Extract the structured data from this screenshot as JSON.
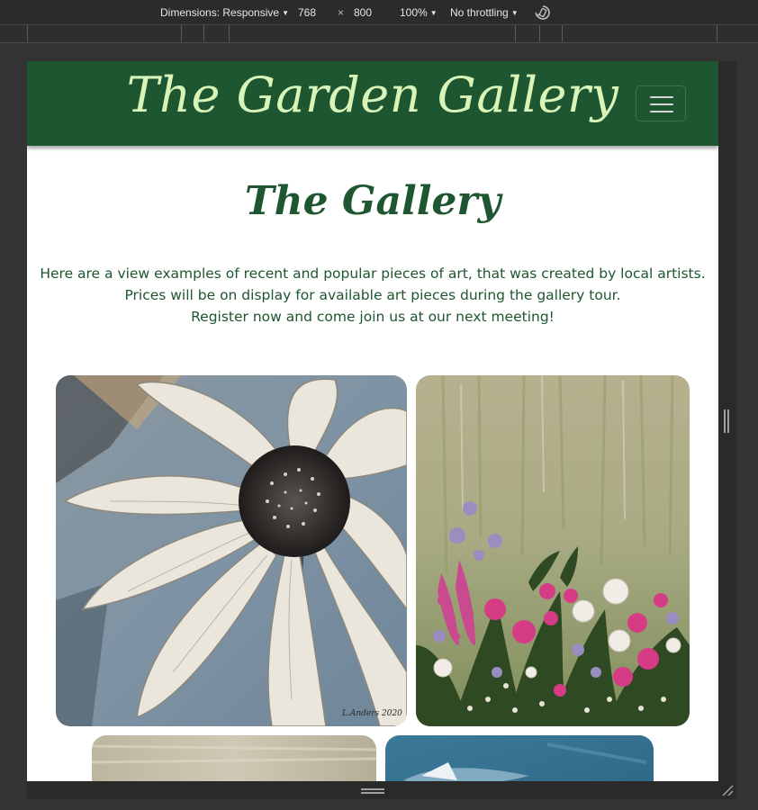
{
  "devtools": {
    "dimensions_label": "Dimensions: Responsive",
    "width": "768",
    "times": "×",
    "height": "800",
    "zoom": "100%",
    "throttling": "No throttling",
    "caret": "▼"
  },
  "header": {
    "brand": "The Garden Gallery",
    "menu_icon": "hamburger-menu-icon"
  },
  "main": {
    "title": "The Gallery",
    "intro": [
      "Here are a view examples of recent and popular pieces of art, that was created by local artists.",
      "Prices will be on display for available art pieces during the gallery tour.",
      "Register now and come join us at our next meeting!"
    ]
  },
  "gallery": [
    {
      "subject": "white daisy painting",
      "signature": "L.Anders 2020"
    },
    {
      "subject": "wildflower meadow painting"
    },
    {
      "subject": "cream abstract painting"
    },
    {
      "subject": "blue abstract painting"
    }
  ],
  "colors": {
    "brand_green": "#1d5630",
    "brand_text": "#d9f4b8",
    "devtools_bg": "#333333"
  }
}
